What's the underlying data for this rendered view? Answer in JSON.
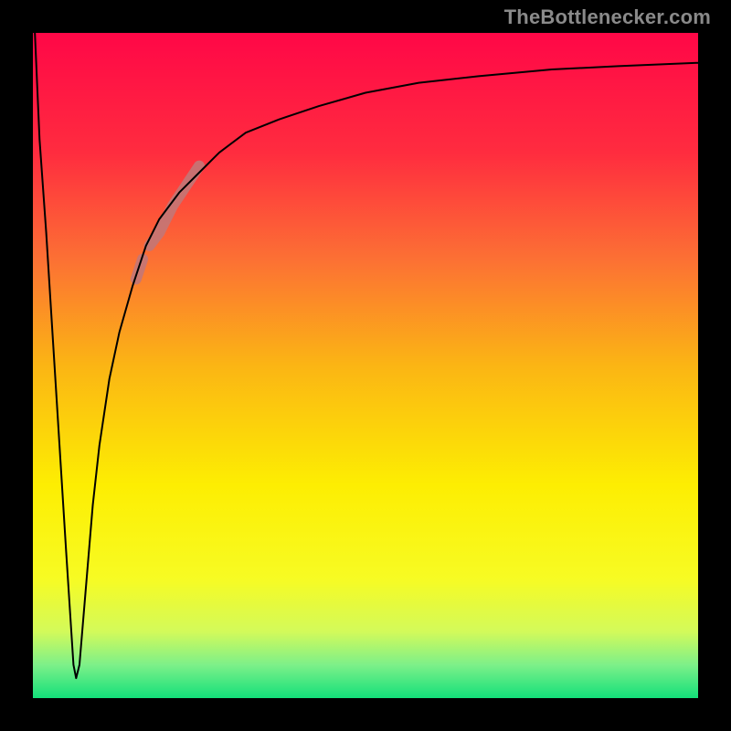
{
  "watermark": {
    "text": "TheBottlenecker.com"
  },
  "chart_data": {
    "type": "line",
    "title": "",
    "xlabel": "",
    "ylabel": "",
    "xlim": [
      0,
      100
    ],
    "ylim": [
      0,
      100
    ],
    "axes_visible": false,
    "grid": false,
    "gradient_stops": [
      {
        "offset": 0.0,
        "color": "#ff0747"
      },
      {
        "offset": 0.18,
        "color": "#ff2c3f"
      },
      {
        "offset": 0.34,
        "color": "#fc7034"
      },
      {
        "offset": 0.5,
        "color": "#fbb514"
      },
      {
        "offset": 0.68,
        "color": "#fdee02"
      },
      {
        "offset": 0.82,
        "color": "#f7fb23"
      },
      {
        "offset": 0.9,
        "color": "#d3fa5a"
      },
      {
        "offset": 0.95,
        "color": "#7df089"
      },
      {
        "offset": 1.0,
        "color": "#13e07a"
      }
    ],
    "series": [
      {
        "name": "bottleneck-curve",
        "stroke": "#000000",
        "stroke_width": 2,
        "x": [
          0.3,
          1.0,
          2.0,
          3.0,
          4.0,
          5.0,
          6.1,
          6.5,
          7.0,
          8.0,
          9.0,
          10.0,
          11.5,
          13.0,
          15.0,
          17.0,
          19.0,
          22.0,
          25.0,
          28.0,
          32.0,
          37.0,
          43.0,
          50.0,
          58.0,
          67.0,
          78.0,
          88.0,
          100.0
        ],
        "values": [
          100,
          84,
          70,
          54,
          38,
          22,
          5,
          3,
          5,
          17,
          29,
          38,
          48,
          55,
          62,
          68,
          72,
          76,
          79,
          82,
          85,
          87,
          89,
          91,
          92.5,
          93.5,
          94.5,
          95,
          95.5
        ]
      }
    ],
    "highlights": [
      {
        "name": "segment-highlight",
        "stroke": "#c37777",
        "stroke_width": 12,
        "opacity": 0.9,
        "x": [
          17.5,
          19.0,
          21.0,
          23.0,
          25.0
        ],
        "values": [
          68,
          70,
          74,
          77,
          80
        ]
      },
      {
        "name": "dot-highlight",
        "stroke": "#c37777",
        "stroke_width": 12,
        "opacity": 0.9,
        "x": [
          15.5,
          16.5
        ],
        "values": [
          63,
          66
        ]
      }
    ]
  }
}
